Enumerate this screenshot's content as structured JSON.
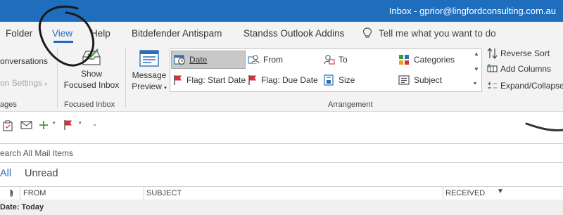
{
  "window": {
    "title": "Inbox - gprior@lingfordconsulting.com.au"
  },
  "menu": {
    "tabs": [
      "Folder",
      "View",
      "Help",
      "Bitdefender Antispam",
      "Standss Outlook Addins"
    ],
    "active_tab": "View",
    "tell_me": "Tell me what you want to do"
  },
  "ribbon": {
    "conversations_label": "onversations",
    "conversation_settings_label": "on Settings",
    "messages_group_label": "ages",
    "show_focused_inbox_line1": "Show",
    "show_focused_inbox_line2": "Focused Inbox",
    "focused_inbox_group_label": "Focused Inbox",
    "message_preview_line1": "Message",
    "message_preview_line2": "Preview",
    "arrangement": {
      "items": [
        {
          "label": "Date",
          "icon": "calendar-clock-icon",
          "selected": true
        },
        {
          "label": "From",
          "icon": "from-person-icon"
        },
        {
          "label": "To",
          "icon": "to-person-icon"
        },
        {
          "label": "Categories",
          "icon": "categories-icon"
        },
        {
          "label": "Flag: Start Date",
          "icon": "red-flag-icon"
        },
        {
          "label": "Flag: Due Date",
          "icon": "red-flag-icon"
        },
        {
          "label": "Size",
          "icon": "size-icon"
        },
        {
          "label": "Subject",
          "icon": "subject-icon"
        }
      ],
      "group_label": "Arrangement"
    },
    "reverse_sort": "Reverse Sort",
    "add_columns": "Add Columns",
    "expand_collapse": "Expand/Collapse"
  },
  "search": {
    "placeholder": "earch All Mail Items"
  },
  "filters": {
    "all": "All",
    "unread": "Unread"
  },
  "columns": {
    "from": "FROM",
    "subject": "SUBJECT",
    "received": "RECEIVED"
  },
  "group_header": "Date: Today",
  "colors": {
    "accent": "#1f6ebd",
    "flag": "#d13438"
  }
}
